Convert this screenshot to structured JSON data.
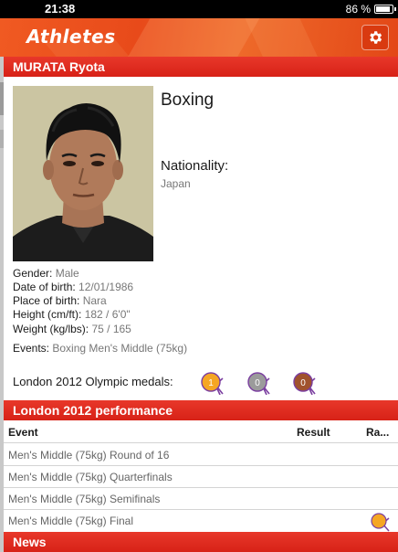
{
  "status": {
    "time": "21:38",
    "battery": "86 %"
  },
  "nav": {
    "title": "Athletes",
    "settings_icon": "gear-icon"
  },
  "athlete": {
    "name": "MURATA Ryota",
    "sport": "Boxing",
    "nationality_label": "Nationality:",
    "nationality": "Japan",
    "details": [
      {
        "label": "Gender:",
        "value": "Male"
      },
      {
        "label": "Date of birth:",
        "value": "12/01/1986"
      },
      {
        "label": "Place of birth:",
        "value": "Nara"
      },
      {
        "label": "Height (cm/ft):",
        "value": "182 / 6'0\""
      },
      {
        "label": "Weight (kg/lbs):",
        "value": "75 / 165"
      }
    ],
    "events_label": "Events:",
    "events": "Boxing Men's Middle (75kg)",
    "medals_label": "London 2012 Olympic medals:",
    "medals": [
      {
        "type": "gold",
        "count": "1",
        "color": "#f5a623"
      },
      {
        "type": "silver",
        "count": "0",
        "color": "#9b9b9b"
      },
      {
        "type": "bronze",
        "count": "0",
        "color": "#a0522d"
      }
    ]
  },
  "performance": {
    "title": "London 2012 performance",
    "columns": {
      "event": "Event",
      "result": "Result",
      "rank": "Ra..."
    },
    "rows": [
      {
        "event": "Men's Middle (75kg) Round of 16",
        "result": "",
        "medal": ""
      },
      {
        "event": "Men's Middle (75kg) Quarterfinals",
        "result": "",
        "medal": ""
      },
      {
        "event": "Men's Middle (75kg) Semifinals",
        "result": "",
        "medal": ""
      },
      {
        "event": "Men's Middle (75kg) Final",
        "result": "",
        "medal": "gold"
      }
    ]
  },
  "news": {
    "title": "News"
  },
  "colors": {
    "header_red": "#e0261c",
    "nav_orange": "#f05a22",
    "gold": "#f5a623",
    "silver": "#9b9b9b",
    "bronze": "#a0522d",
    "ribbon": "#7b3fa0"
  }
}
